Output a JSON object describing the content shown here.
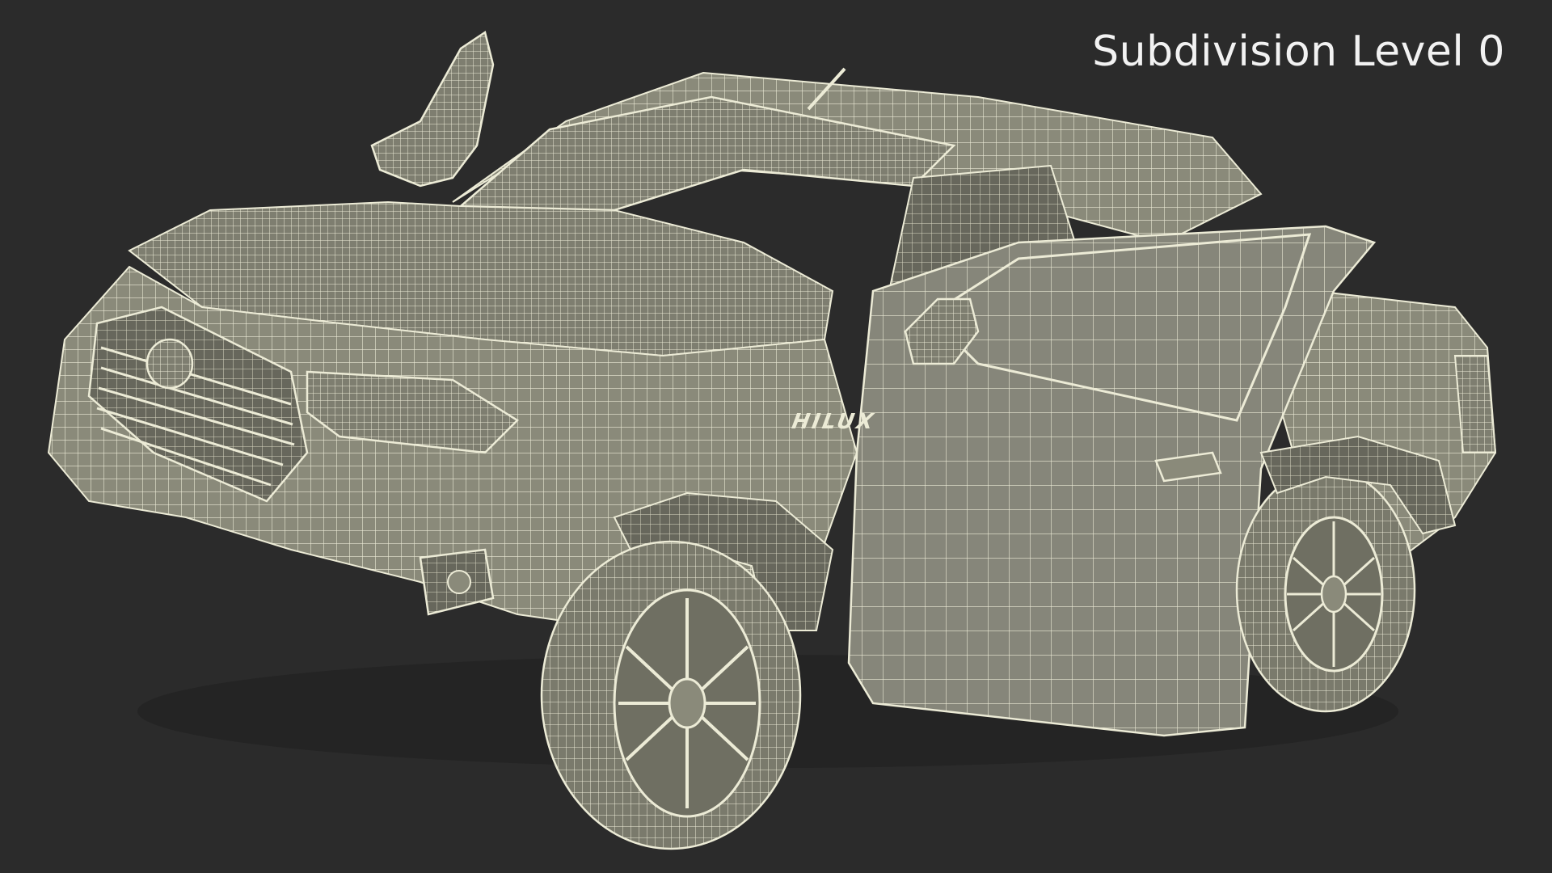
{
  "viewport": {
    "label": "Subdivision Level 0",
    "background_color": "#2b2b2b"
  },
  "model": {
    "badge_text": "HILUX",
    "surface_color": "#8a8a7a",
    "surface_dark_color": "#6f6f62",
    "wire_color": "#ecebd6",
    "shadow_color": "#1f1f1f"
  }
}
